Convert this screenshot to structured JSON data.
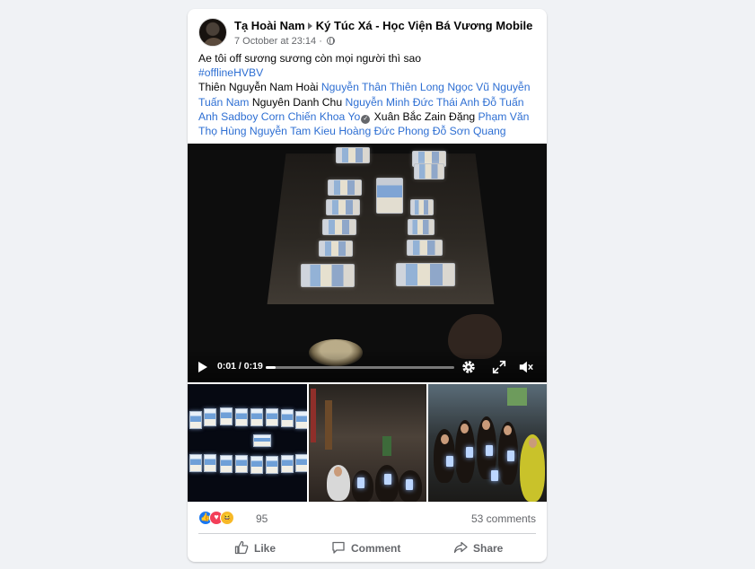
{
  "post": {
    "author": "Tạ Hoài Nam",
    "group": "Ký Túc Xá - Học Viện Bá Vương Mobile",
    "time": "7 October at 23:14",
    "privacy_icon": "globe-icon",
    "caption": "Ae tôi off sương sương còn mọi người thì sao",
    "hashtag": "#offlineHVBV",
    "tags": [
      {
        "text": "Thiên Nguyễn Nam Hoài",
        "link": false
      },
      {
        "text": "Nguyễn Thân Thiên Long",
        "link": true
      },
      {
        "text": "Ngọc Vũ",
        "link": true
      },
      {
        "text": "Nguyễn Tuấn Nam",
        "link": true
      },
      {
        "text": "Nguyên Danh Chu",
        "link": false
      },
      {
        "text": "Nguyễn Minh Đức",
        "link": true
      },
      {
        "text": "Thái Anh",
        "link": true
      },
      {
        "text": "Đỗ Tuấn Anh",
        "link": true
      },
      {
        "text": "Sadboy Corn",
        "link": true
      },
      {
        "text": "Chiến Khoa",
        "link": true
      },
      {
        "text": "Yo",
        "link": true
      },
      {
        "text": "Xuân Bắc",
        "link": false
      },
      {
        "text": "Zain Đặng",
        "link": false
      },
      {
        "text": "Phạm Văn Thọ",
        "link": true
      },
      {
        "text": "Hùng Nguyễn",
        "link": true
      },
      {
        "text": "Tam Kieu",
        "link": true
      },
      {
        "text": "Hoàng Đức Phong",
        "link": true
      },
      {
        "text": "Đỗ Sơn Quang",
        "link": true
      }
    ]
  },
  "video": {
    "time_display": "0:01 / 0:19",
    "progress_fraction": 0.05
  },
  "stats": {
    "reaction_count": "95",
    "comments": "53 comments"
  },
  "actions": {
    "like": "Like",
    "comment": "Comment",
    "share": "Share"
  },
  "colors": {
    "link": "#2e6fd3",
    "like_reaction": "#1877f2",
    "love_reaction": "#f33e58",
    "haha_reaction": "#f7b928"
  }
}
